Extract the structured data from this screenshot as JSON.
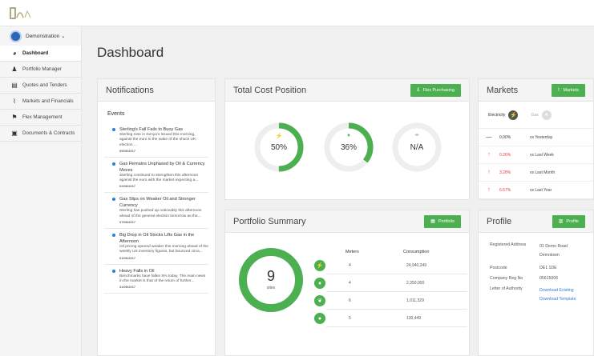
{
  "header": {
    "logo": "logo"
  },
  "user": {
    "name": "Demonstration ⌄"
  },
  "sidebar": {
    "items": [
      {
        "label": "Dashboard",
        "icon": "dashboard-icon"
      },
      {
        "label": "Portfolio Manager",
        "icon": "user-icon"
      },
      {
        "label": "Quotes and Tenders",
        "icon": "document-icon"
      },
      {
        "label": "Markets and Financials",
        "icon": "line-chart-icon"
      },
      {
        "label": "Flex Management",
        "icon": "flex-icon"
      },
      {
        "label": "Documents & Contracts",
        "icon": "folder-icon"
      }
    ]
  },
  "page": {
    "title": "Dashboard"
  },
  "notifications": {
    "title": "Notifications",
    "events_label": "Events",
    "events": [
      {
        "title": "Sterling's Fall Fails to Buoy Gas",
        "body": "Sterling rose in Kenya's Issued this morning, against the euro in the wake of the shock UK election ...",
        "date": "05/06/2017"
      },
      {
        "title": "Gas Remains Unphased by Oil & Currency Moves",
        "body": "Sterling continued to strengthen this afternoon against the euro with the market expecting a...",
        "date": "02/06/2017"
      },
      {
        "title": "Gas Slips on Weaker Oil and Stronger Currency",
        "body": "Sterling has pushed up noticeably this afternoon ahead of the general election tomorrow as the...",
        "date": "07/06/2017"
      },
      {
        "title": "Big Drop in Oil Stocks Lifts Gas in the Afternoon",
        "body": "Oil pricing opened weaker this morning ahead of the weekly US inventory figures, but bounced circa...",
        "date": "01/06/2017"
      },
      {
        "title": "Heavy Falls in Oil",
        "body": "Benchmarks have fallen 5% today. The main news in the market is that of the return of further...",
        "date": "31/05/2017"
      }
    ]
  },
  "cost": {
    "title": "Total Cost Position",
    "button": "Flex Purchasing",
    "rings": [
      {
        "label": "50%",
        "value": 50,
        "icon": "lightning-icon",
        "color": "#4caf50"
      },
      {
        "label": "36%",
        "value": 36,
        "icon": "flame-icon",
        "color": "#4caf50"
      },
      {
        "label": "N/A",
        "value": 0,
        "icon": "water-icon",
        "color": "#cccccc"
      }
    ]
  },
  "markets": {
    "title": "Markets",
    "button": "Markets",
    "tabs": [
      "Electricity",
      "Gas"
    ],
    "rows": [
      {
        "arrow": "—",
        "value": "0.00%",
        "compare": "vs Yesterday",
        "color": "#333333"
      },
      {
        "arrow": "↑",
        "value": "0.26%",
        "compare": "vs Last Week",
        "color": "#e53935"
      },
      {
        "arrow": "↑",
        "value": "3.28%",
        "compare": "vs Last Month",
        "color": "#e53935"
      },
      {
        "arrow": "↑",
        "value": "6.67%",
        "compare": "vs Last Year",
        "color": "#e53935"
      }
    ]
  },
  "portfolio": {
    "title": "Portfolio Summary",
    "button": "Portfolio",
    "sites_count": "9",
    "sites_label": "sites",
    "col_meters": "Meters",
    "col_consumption": "Consumption",
    "rows": [
      {
        "icon": "lightning-icon",
        "meters": "4",
        "consumption": "24,940,349"
      },
      {
        "icon": "flame-icon",
        "meters": "4",
        "consumption": "2,350,000"
      },
      {
        "icon": "leaf-icon",
        "meters": "6",
        "consumption": "1,011,329"
      },
      {
        "icon": "water-icon",
        "meters": "5",
        "consumption": "130,449"
      }
    ]
  },
  "profile": {
    "title": "Profile",
    "button": "Profile",
    "address_label": "Registered Address",
    "address_line1": "01 Demo Road",
    "address_line2": "Demotown",
    "postcode_label": "Postcode",
    "postcode": "DE1 1DE",
    "company_label": "Company Reg No",
    "company": "05615006",
    "loa_label": "Letter of Authority",
    "loa_link1": "Download Existing",
    "loa_link2": "Download Template"
  }
}
